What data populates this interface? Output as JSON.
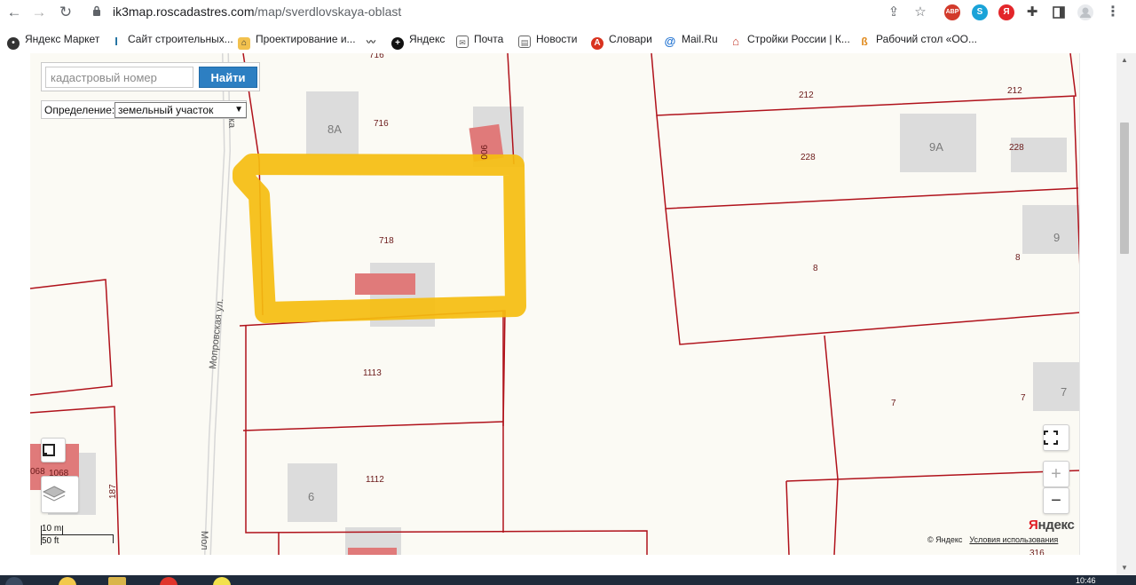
{
  "browser": {
    "url_host": "ik3map.roscadastres.com",
    "url_path": "/map/sverdlovskaya-oblast",
    "ext_abp": "ABP",
    "bookmarks": [
      {
        "label": "Яндекс Маркет"
      },
      {
        "label": "Сайт строительных..."
      },
      {
        "label": "Проектирование и..."
      },
      {
        "label": ""
      },
      {
        "label": "Яндекс"
      },
      {
        "label": "Почта"
      },
      {
        "label": "Новости"
      },
      {
        "label": "Словари"
      },
      {
        "label": "Mail.Ru"
      },
      {
        "label": "Стройки России | К..."
      },
      {
        "label": "Рабочий стол «ОО..."
      }
    ]
  },
  "search": {
    "placeholder": "кадастровый номер",
    "button_label": "Найти"
  },
  "definition": {
    "label": "Определение:",
    "selected": "земельный участок"
  },
  "map": {
    "plot_numbers": {
      "p716_top": "716",
      "p716": "716",
      "p718": "718",
      "p1113": "1113",
      "p1112": "1112",
      "p212a": "212",
      "p212b": "212",
      "p228a": "228",
      "p228b": "228",
      "p8a": "8",
      "p8b": "8",
      "p7a": "7",
      "p7b": "7",
      "p187": "187",
      "p1068a": "068",
      "p1068b": "1068",
      "p900": "900",
      "p316": "316"
    },
    "house_numbers": {
      "h8a": "8А",
      "h9a": "9А",
      "h9": "9",
      "h7": "7",
      "h6": "6"
    },
    "streets": {
      "main": "Мопровская ул.",
      "bottom": "Мол",
      "top": "ка"
    },
    "highlight_color": "#f5bd0f",
    "boundary_color": "#b0121b",
    "building_color": "#e07a7a"
  },
  "scale": {
    "metric": "10 m",
    "imperial": "50 ft"
  },
  "attribution": {
    "logo_y": "Я",
    "logo_rest": "ндекс",
    "copyright": "© Яндекс",
    "terms": "Условия использования"
  },
  "controls": {
    "zoom_in": "+",
    "zoom_out": "−"
  },
  "taskbar": {
    "clock": "10:46"
  }
}
